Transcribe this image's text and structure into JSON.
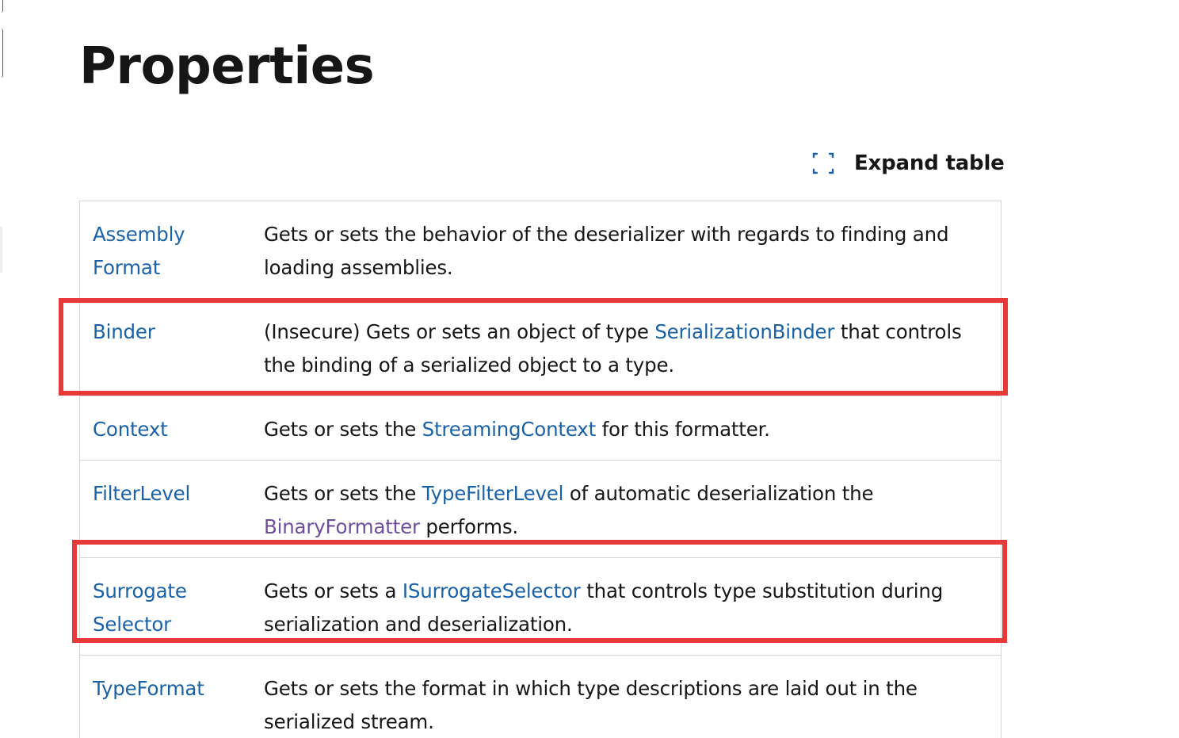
{
  "page": {
    "title": "Properties"
  },
  "expand_button": {
    "label": "Expand table",
    "icon": "expand-icon"
  },
  "colors": {
    "link": "#1a62a8",
    "visited_link": "#6f4e9c",
    "highlight": "#e63a3a",
    "border": "#d6d6d6"
  },
  "properties": [
    {
      "name": "Assembly​Format",
      "desc_before": "Gets or sets the behavior of the deserializer with regards to finding and loading assemblies.",
      "desc_link": "",
      "desc_after": ""
    },
    {
      "name": "Binder",
      "desc_before": "(Insecure) Gets or sets an object of type ",
      "desc_link": "SerializationBinder",
      "desc_after": " that controls the binding of a serialized object to a type."
    },
    {
      "name": "Context",
      "desc_before": "Gets or sets the ",
      "desc_link": "StreamingContext",
      "desc_after": " for this formatter."
    },
    {
      "name": "FilterLevel",
      "desc_before": "Gets or sets the ",
      "desc_link": "TypeFilterLevel",
      "desc_middle": " of automatic deserialization the ",
      "desc_link2": "BinaryFormatter",
      "desc_after": " performs."
    },
    {
      "name": "Surrogate​Selector",
      "desc_before": "Gets or sets a ",
      "desc_link": "ISurrogateSelector",
      "desc_after": " that controls type substitution during serialization and deserialization."
    },
    {
      "name": "TypeFormat",
      "desc_before": "Gets or sets the format in which type descriptions are laid out in the serialized stream.",
      "desc_link": "",
      "desc_after": ""
    }
  ]
}
